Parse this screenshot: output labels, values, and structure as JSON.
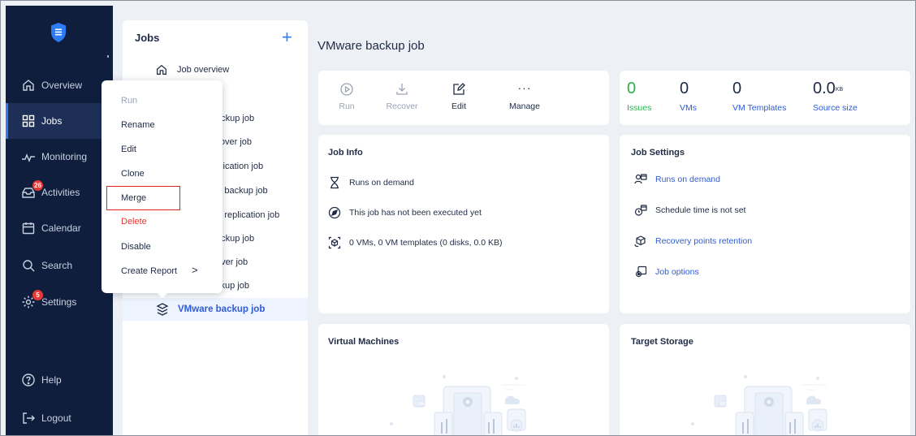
{
  "sidebar": {
    "items": [
      {
        "label": "Overview",
        "icon": "home-icon"
      },
      {
        "label": "Jobs",
        "icon": "grid-icon"
      },
      {
        "label": "Monitoring",
        "icon": "pulse-icon"
      },
      {
        "label": "Activities",
        "icon": "activities-icon",
        "badge": "26"
      },
      {
        "label": "Calendar",
        "icon": "calendar-icon"
      },
      {
        "label": "Search",
        "icon": "search-icon"
      },
      {
        "label": "Settings",
        "icon": "gear-icon",
        "badge": "5"
      }
    ],
    "help": "Help",
    "logout": "Logout"
  },
  "jobs_panel": {
    "title": "Jobs",
    "add_symbol": "+",
    "overview": "Job overview",
    "jobs": [
      "ackup job",
      "ilover job",
      "plication job",
      "V backup job",
      "V replication job",
      "ackup job",
      "over job",
      "ckup job"
    ],
    "selected_job": "VMware backup job"
  },
  "context_menu": {
    "items": [
      "Run",
      "Rename",
      "Edit",
      "Clone",
      "Merge",
      "Delete",
      "Disable",
      "Create Report"
    ],
    "submenu_chevron": ">"
  },
  "main": {
    "title": "VMware backup job",
    "toolbar": {
      "run": "Run",
      "recover": "Recover",
      "edit": "Edit",
      "manage": "Manage",
      "manage_glyph": "···"
    },
    "stats": {
      "issues": {
        "value": "0",
        "label": "Issues"
      },
      "vms": {
        "value": "0",
        "label": "VMs"
      },
      "vm_templates": {
        "value": "0",
        "label": "VM Templates"
      },
      "source_size": {
        "value": "0.0",
        "unit": "KB",
        "label": "Source size"
      }
    },
    "job_info": {
      "title": "Job Info",
      "rows": [
        "Runs on demand",
        "This job has not been executed yet",
        "0 VMs, 0 VM templates (0 disks, 0.0 KB)"
      ]
    },
    "job_settings": {
      "title": "Job Settings",
      "rows": [
        "Runs on demand",
        "Schedule time is not set",
        "Recovery points retention",
        "Job options"
      ]
    },
    "virtual_machines": {
      "title": "Virtual Machines"
    },
    "target_storage": {
      "title": "Target Storage"
    }
  },
  "colors": {
    "sidebar_bg": "#0f1e3d",
    "accent_blue": "#2e7bf6",
    "link_blue": "#2e5bd6",
    "issues_green": "#2bb24c",
    "delete_red": "#e53935",
    "badge_red": "#e53935"
  }
}
